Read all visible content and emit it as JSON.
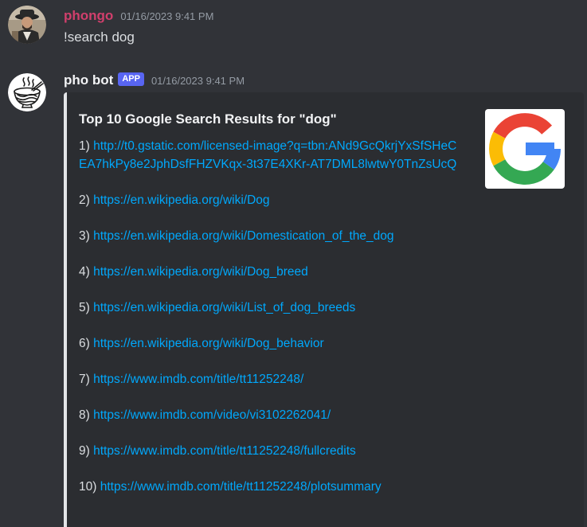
{
  "messages": [
    {
      "username": "phongo",
      "timestamp": "01/16/2023 9:41 PM",
      "content": "!search dog",
      "avatar": "user-avatar"
    },
    {
      "username": "pho bot",
      "badge": "APP",
      "timestamp": "01/16/2023 9:41 PM",
      "avatar": "bot-noodle-bowl-avatar",
      "embed": {
        "title": "Top 10 Google Search Results for \"dog\"",
        "thumbnail_icon": "google-logo",
        "results": [
          {
            "index": "1)",
            "url": "http://t0.gstatic.com/licensed-image?q=tbn:ANd9GcQkrjYxSfSHeCEA7hkPy8e2JphDsfFHZVKqx-3t37E4XKr-AT7DML8lwtwY0TnZsUcQ"
          },
          {
            "index": "2)",
            "url": "https://en.wikipedia.org/wiki/Dog"
          },
          {
            "index": "3)",
            "url": "https://en.wikipedia.org/wiki/Domestication_of_the_dog"
          },
          {
            "index": "4)",
            "url": "https://en.wikipedia.org/wiki/Dog_breed"
          },
          {
            "index": "5)",
            "url": "https://en.wikipedia.org/wiki/List_of_dog_breeds"
          },
          {
            "index": "6)",
            "url": "https://en.wikipedia.org/wiki/Dog_behavior"
          },
          {
            "index": "7)",
            "url": "https://www.imdb.com/title/tt11252248/"
          },
          {
            "index": "8)",
            "url": "https://www.imdb.com/video/vi3102262041/"
          },
          {
            "index": "9)",
            "url": "https://www.imdb.com/title/tt11252248/fullcredits"
          },
          {
            "index": "10)",
            "url": "https://www.imdb.com/title/tt11252248/plotsummary"
          }
        ]
      }
    }
  ],
  "colors": {
    "background": "#313338",
    "embed_background": "#2b2d31",
    "link": "#00a8fc",
    "phongo_name": "#d13f6c",
    "app_badge": "#5865f2"
  }
}
